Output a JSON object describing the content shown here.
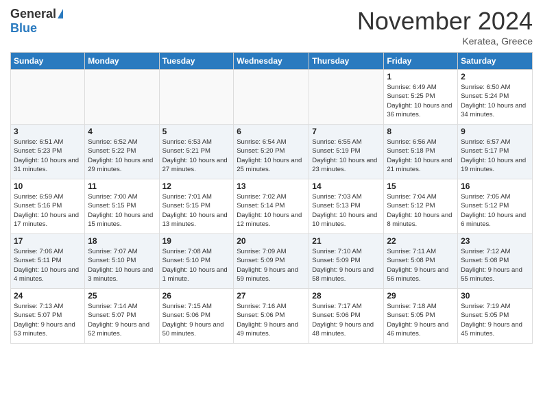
{
  "logo": {
    "general": "General",
    "blue": "Blue"
  },
  "header": {
    "month": "November 2024",
    "location": "Keratea, Greece"
  },
  "weekdays": [
    "Sunday",
    "Monday",
    "Tuesday",
    "Wednesday",
    "Thursday",
    "Friday",
    "Saturday"
  ],
  "weeks": [
    [
      {
        "day": "",
        "info": "",
        "empty": true
      },
      {
        "day": "",
        "info": "",
        "empty": true
      },
      {
        "day": "",
        "info": "",
        "empty": true
      },
      {
        "day": "",
        "info": "",
        "empty": true
      },
      {
        "day": "",
        "info": "",
        "empty": true
      },
      {
        "day": "1",
        "info": "Sunrise: 6:49 AM\nSunset: 5:25 PM\nDaylight: 10 hours and 36 minutes."
      },
      {
        "day": "2",
        "info": "Sunrise: 6:50 AM\nSunset: 5:24 PM\nDaylight: 10 hours and 34 minutes."
      }
    ],
    [
      {
        "day": "3",
        "info": "Sunrise: 6:51 AM\nSunset: 5:23 PM\nDaylight: 10 hours and 31 minutes."
      },
      {
        "day": "4",
        "info": "Sunrise: 6:52 AM\nSunset: 5:22 PM\nDaylight: 10 hours and 29 minutes."
      },
      {
        "day": "5",
        "info": "Sunrise: 6:53 AM\nSunset: 5:21 PM\nDaylight: 10 hours and 27 minutes."
      },
      {
        "day": "6",
        "info": "Sunrise: 6:54 AM\nSunset: 5:20 PM\nDaylight: 10 hours and 25 minutes."
      },
      {
        "day": "7",
        "info": "Sunrise: 6:55 AM\nSunset: 5:19 PM\nDaylight: 10 hours and 23 minutes."
      },
      {
        "day": "8",
        "info": "Sunrise: 6:56 AM\nSunset: 5:18 PM\nDaylight: 10 hours and 21 minutes."
      },
      {
        "day": "9",
        "info": "Sunrise: 6:57 AM\nSunset: 5:17 PM\nDaylight: 10 hours and 19 minutes."
      }
    ],
    [
      {
        "day": "10",
        "info": "Sunrise: 6:59 AM\nSunset: 5:16 PM\nDaylight: 10 hours and 17 minutes."
      },
      {
        "day": "11",
        "info": "Sunrise: 7:00 AM\nSunset: 5:15 PM\nDaylight: 10 hours and 15 minutes."
      },
      {
        "day": "12",
        "info": "Sunrise: 7:01 AM\nSunset: 5:15 PM\nDaylight: 10 hours and 13 minutes."
      },
      {
        "day": "13",
        "info": "Sunrise: 7:02 AM\nSunset: 5:14 PM\nDaylight: 10 hours and 12 minutes."
      },
      {
        "day": "14",
        "info": "Sunrise: 7:03 AM\nSunset: 5:13 PM\nDaylight: 10 hours and 10 minutes."
      },
      {
        "day": "15",
        "info": "Sunrise: 7:04 AM\nSunset: 5:12 PM\nDaylight: 10 hours and 8 minutes."
      },
      {
        "day": "16",
        "info": "Sunrise: 7:05 AM\nSunset: 5:12 PM\nDaylight: 10 hours and 6 minutes."
      }
    ],
    [
      {
        "day": "17",
        "info": "Sunrise: 7:06 AM\nSunset: 5:11 PM\nDaylight: 10 hours and 4 minutes."
      },
      {
        "day": "18",
        "info": "Sunrise: 7:07 AM\nSunset: 5:10 PM\nDaylight: 10 hours and 3 minutes."
      },
      {
        "day": "19",
        "info": "Sunrise: 7:08 AM\nSunset: 5:10 PM\nDaylight: 10 hours and 1 minute."
      },
      {
        "day": "20",
        "info": "Sunrise: 7:09 AM\nSunset: 5:09 PM\nDaylight: 9 hours and 59 minutes."
      },
      {
        "day": "21",
        "info": "Sunrise: 7:10 AM\nSunset: 5:09 PM\nDaylight: 9 hours and 58 minutes."
      },
      {
        "day": "22",
        "info": "Sunrise: 7:11 AM\nSunset: 5:08 PM\nDaylight: 9 hours and 56 minutes."
      },
      {
        "day": "23",
        "info": "Sunrise: 7:12 AM\nSunset: 5:08 PM\nDaylight: 9 hours and 55 minutes."
      }
    ],
    [
      {
        "day": "24",
        "info": "Sunrise: 7:13 AM\nSunset: 5:07 PM\nDaylight: 9 hours and 53 minutes."
      },
      {
        "day": "25",
        "info": "Sunrise: 7:14 AM\nSunset: 5:07 PM\nDaylight: 9 hours and 52 minutes."
      },
      {
        "day": "26",
        "info": "Sunrise: 7:15 AM\nSunset: 5:06 PM\nDaylight: 9 hours and 50 minutes."
      },
      {
        "day": "27",
        "info": "Sunrise: 7:16 AM\nSunset: 5:06 PM\nDaylight: 9 hours and 49 minutes."
      },
      {
        "day": "28",
        "info": "Sunrise: 7:17 AM\nSunset: 5:06 PM\nDaylight: 9 hours and 48 minutes."
      },
      {
        "day": "29",
        "info": "Sunrise: 7:18 AM\nSunset: 5:05 PM\nDaylight: 9 hours and 46 minutes."
      },
      {
        "day": "30",
        "info": "Sunrise: 7:19 AM\nSunset: 5:05 PM\nDaylight: 9 hours and 45 minutes."
      }
    ]
  ]
}
